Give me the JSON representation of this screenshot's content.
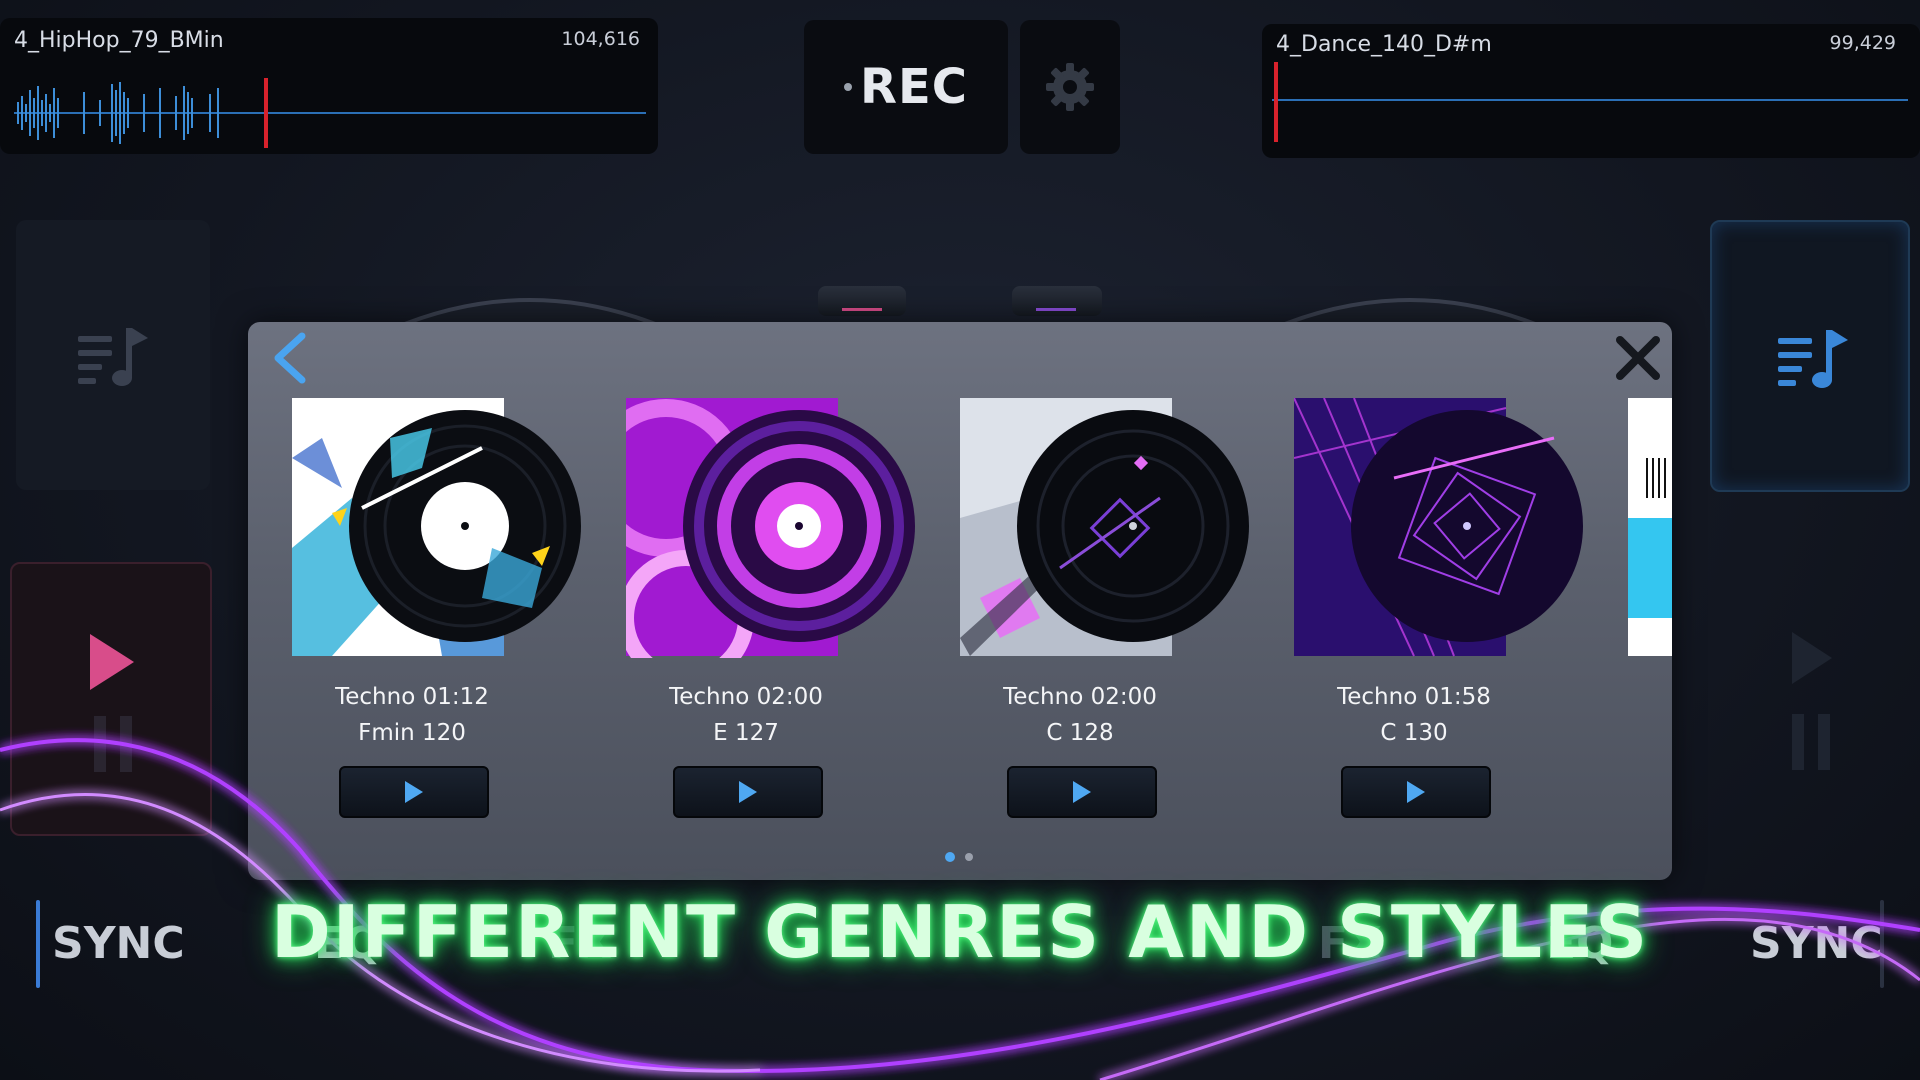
{
  "deck_left": {
    "track": "4_HipHop_79_BMin",
    "count": "104,616"
  },
  "deck_right": {
    "track": "4_Dance_140_D#m",
    "count": "99,429"
  },
  "rec": {
    "label": "REC"
  },
  "bottom_left": {
    "sync": "SYNC",
    "eq": "EQ",
    "fx": "FX"
  },
  "bottom_right": {
    "sync": "SYNC",
    "eq": "EQ",
    "fx": "FX"
  },
  "headline": "DIFFERENT GENRES AND STYLES",
  "library": {
    "cards": [
      {
        "title": "Techno 01:12",
        "meta": "Fmin 120"
      },
      {
        "title": "Techno 02:00",
        "meta": "E 127"
      },
      {
        "title": "Techno 02:00",
        "meta": "C 128"
      },
      {
        "title": "Techno 01:58",
        "meta": "C 130"
      }
    ],
    "pagination": {
      "pages": 2,
      "current": 1
    }
  },
  "colors": {
    "accent_blue": "#3a7bd5",
    "playhead_red": "#d8222c",
    "neon_green": "#5dff8a",
    "neon_purple": "#b040ff"
  },
  "icons": [
    "back-arrow-icon",
    "close-icon",
    "gear-icon",
    "playlist-icon",
    "play-icon",
    "pause-icon"
  ]
}
